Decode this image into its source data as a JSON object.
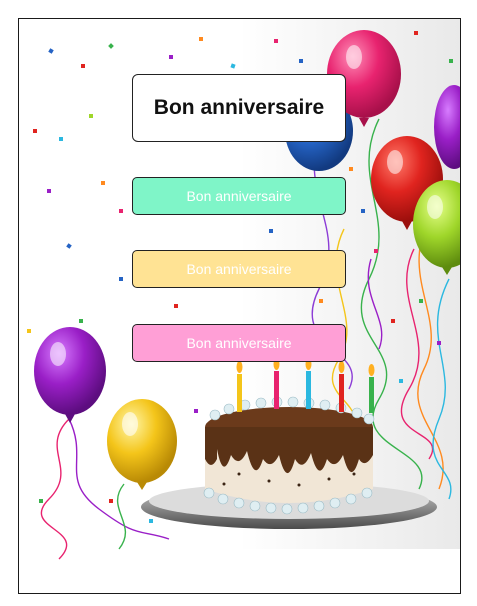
{
  "card": {
    "title": "Bon anniversaire",
    "buttons": [
      {
        "label": "Bon anniversaire",
        "color": "#7ff5c8"
      },
      {
        "label": "Bon anniversaire",
        "color": "#ffe394"
      },
      {
        "label": "Bon anniversaire",
        "color": "#ff9fd6"
      }
    ]
  },
  "colors": {
    "balloon_pink": "#e8236f",
    "balloon_red": "#e0241f",
    "balloon_purple": "#9a1fc7",
    "balloon_green": "#9fd62a",
    "balloon_blue": "#2563c4",
    "balloon_yellow": "#f4c51a",
    "cake_chocolate": "#5a3216"
  }
}
